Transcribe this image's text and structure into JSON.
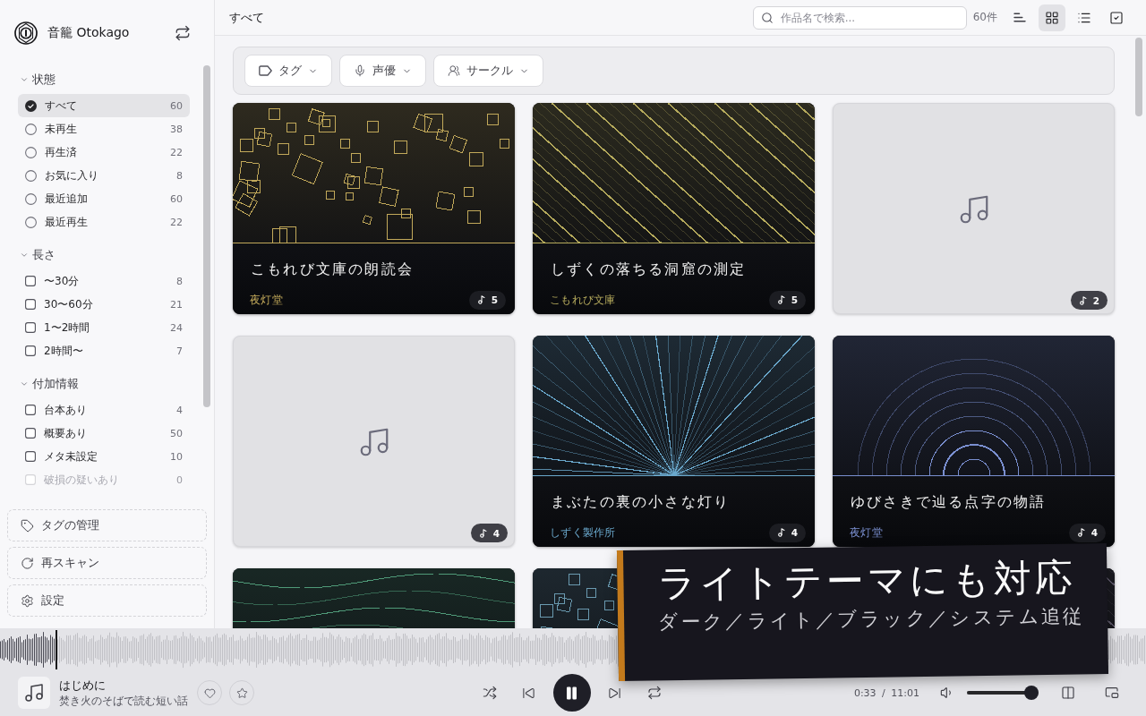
{
  "app": {
    "name": "音籠 Otokago"
  },
  "sidebar": {
    "sections": [
      {
        "title": "状態",
        "expanded": true,
        "items": [
          {
            "kind": "radio",
            "label": "すべて",
            "count": "60",
            "selected": true,
            "disabled": false
          },
          {
            "kind": "radio",
            "label": "未再生",
            "count": "38",
            "selected": false,
            "disabled": false
          },
          {
            "kind": "radio",
            "label": "再生済",
            "count": "22",
            "selected": false,
            "disabled": false
          },
          {
            "kind": "radio",
            "label": "お気に入り",
            "count": "8",
            "selected": false,
            "disabled": false
          },
          {
            "kind": "radio",
            "label": "最近追加",
            "count": "60",
            "selected": false,
            "disabled": false
          },
          {
            "kind": "radio",
            "label": "最近再生",
            "count": "22",
            "selected": false,
            "disabled": false
          }
        ]
      },
      {
        "title": "長さ",
        "expanded": true,
        "items": [
          {
            "kind": "checkbox",
            "label": "〜30分",
            "count": "8",
            "checked": false,
            "disabled": false
          },
          {
            "kind": "checkbox",
            "label": "30〜60分",
            "count": "21",
            "checked": false,
            "disabled": false
          },
          {
            "kind": "checkbox",
            "label": "1〜2時間",
            "count": "24",
            "checked": false,
            "disabled": false
          },
          {
            "kind": "checkbox",
            "label": "2時間〜",
            "count": "7",
            "checked": false,
            "disabled": false
          }
        ]
      },
      {
        "title": "付加情報",
        "expanded": true,
        "items": [
          {
            "kind": "checkbox",
            "label": "台本あり",
            "count": "4",
            "checked": false,
            "disabled": false
          },
          {
            "kind": "checkbox",
            "label": "概要あり",
            "count": "50",
            "checked": false,
            "disabled": false
          },
          {
            "kind": "checkbox",
            "label": "メタ未設定",
            "count": "10",
            "checked": false,
            "disabled": false
          },
          {
            "kind": "checkbox",
            "label": "破損の疑いあり",
            "count": "0",
            "checked": false,
            "disabled": true
          }
        ]
      }
    ],
    "actions": [
      {
        "kind": "tags",
        "label": "タグの管理"
      },
      {
        "kind": "rescan",
        "label": "再スキャン"
      },
      {
        "kind": "settings",
        "label": "設定"
      }
    ]
  },
  "toolbar": {
    "title": "すべて",
    "search": {
      "placeholder": "作品名で検索..."
    },
    "count": "60件",
    "views": [
      {
        "kind": "sort",
        "selected": false
      },
      {
        "kind": "grid",
        "selected": true
      },
      {
        "kind": "list",
        "selected": false
      },
      {
        "kind": "select",
        "selected": false
      }
    ]
  },
  "filters": [
    {
      "kind": "tag",
      "label": "タグ"
    },
    {
      "kind": "voice",
      "label": "声優"
    },
    {
      "kind": "circle",
      "label": "サークル"
    }
  ],
  "cards": [
    {
      "kind": "squares",
      "color": "#c2a95a",
      "title": "こもれび文庫の朗読会",
      "circle": "夜灯堂",
      "tracks": "5"
    },
    {
      "kind": "diagonals",
      "color": "#b5aa5c",
      "title": "しずくの落ちる洞窟の測定",
      "circle": "こもれび文庫",
      "tracks": "5"
    },
    {
      "kind": "placeholder",
      "tracks": "2"
    },
    {
      "kind": "placeholder",
      "tracks": "4"
    },
    {
      "kind": "rays",
      "color": "#6aa8cc",
      "title": "まぶたの裏の小さな灯り",
      "circle": "しずく製作所",
      "tracks": "4"
    },
    {
      "kind": "arcs",
      "color": "#7a8fd0",
      "title": "ゆびさきで辿る点字の物語",
      "circle": "夜灯堂",
      "tracks": "4"
    },
    {
      "kind": "waves",
      "color": "#4f9a78"
    },
    {
      "kind": "squares",
      "color": "#6a9ab0"
    },
    {
      "kind": "diagonals"
    }
  ],
  "player": {
    "title": "はじめに",
    "work": "焚き火のそばで読む短い話",
    "favorite": false,
    "starred": false,
    "playing": true,
    "seek": {
      "level": 0.05
    },
    "time": "0:33 / 11:01",
    "volume": {
      "level": 0.9
    }
  },
  "banner": {
    "title": "ライトテーマにも対応",
    "subtitle": "ダーク／ライト／ブラック／システム追従"
  }
}
